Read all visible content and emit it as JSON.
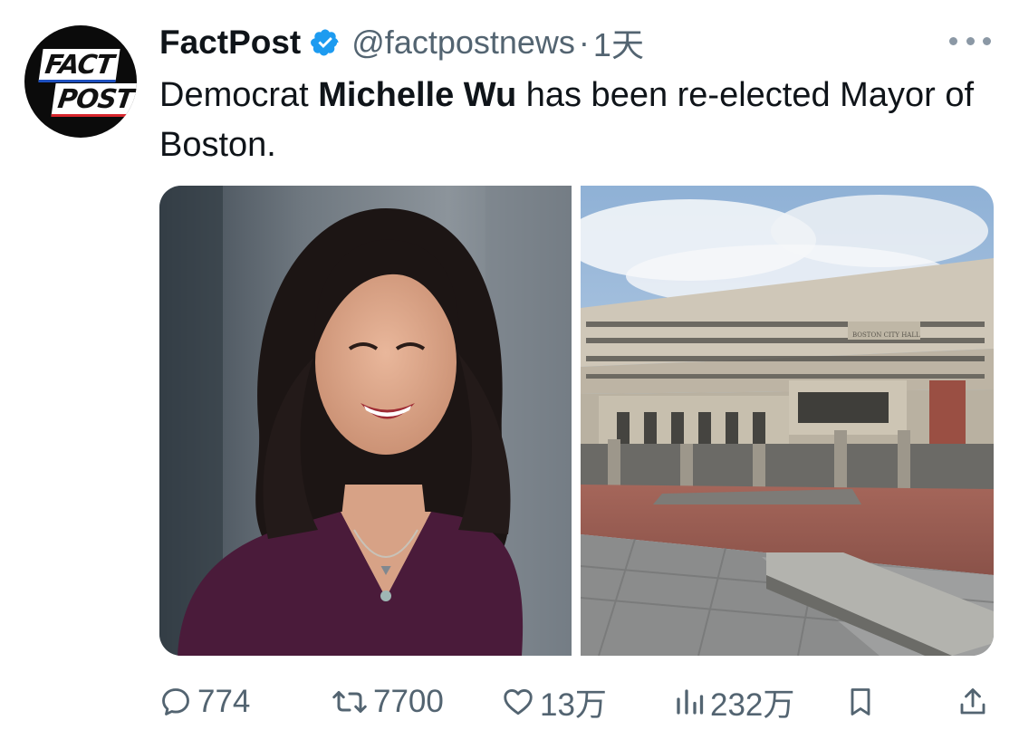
{
  "author": {
    "display_name": "FactPost",
    "handle": "@factpostnews",
    "separator": "·",
    "time": "1天",
    "verified": true,
    "avatar_text_top": "FACT",
    "avatar_text_bottom": "POST"
  },
  "tweet": {
    "text_pre": "Democrat ",
    "text_bold": "Michelle Wu",
    "text_post": " has been re-elected Mayor of Boston."
  },
  "media": {
    "images": [
      {
        "name": "michelle-wu-portrait",
        "kind": "photo"
      },
      {
        "name": "boston-city-hall",
        "kind": "photo",
        "sign_text": "BOSTON CITY HALL"
      }
    ]
  },
  "actions": {
    "reply_count": "774",
    "retweet_count": "7700",
    "like_count": "13万",
    "views_count": "232万"
  },
  "colors": {
    "text_primary": "#0f1419",
    "text_secondary": "#536471",
    "verified_blue": "#1d9bf0"
  },
  "icons": [
    "more-icon",
    "verified-badge-icon",
    "reply-icon",
    "retweet-icon",
    "like-icon",
    "views-icon",
    "bookmark-icon",
    "share-icon"
  ]
}
